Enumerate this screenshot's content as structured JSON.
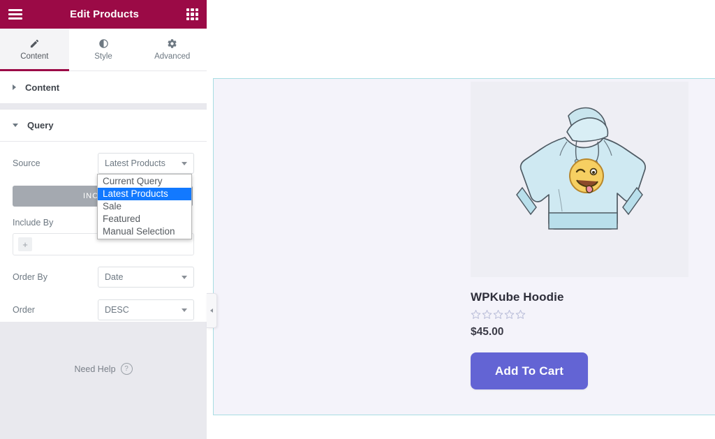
{
  "panel": {
    "header": {
      "title": "Edit Products",
      "menu_icon": "hamburger-icon",
      "apps_icon": "grid-apps-icon"
    },
    "tabs": [
      {
        "label": "Content",
        "icon": "pencil-icon",
        "active": true
      },
      {
        "label": "Style",
        "icon": "contrast-icon",
        "active": false
      },
      {
        "label": "Advanced",
        "icon": "gear-icon",
        "active": false
      }
    ],
    "sections": [
      {
        "label": "Content",
        "expanded": false
      },
      {
        "label": "Query",
        "expanded": true
      }
    ],
    "controls": {
      "source": {
        "label": "Source",
        "value": "Latest Products",
        "options": [
          "Current Query",
          "Latest Products",
          "Sale",
          "Featured",
          "Manual Selection"
        ],
        "selected_option": "Latest Products"
      },
      "include_button": "INCLUDE",
      "include_by": {
        "label": "Include By",
        "add_chip": "+"
      },
      "order_by": {
        "label": "Order By",
        "value": "Date"
      },
      "order": {
        "label": "Order",
        "value": "DESC"
      }
    },
    "footer": {
      "need_help": "Need Help",
      "help_icon": "question-mark-icon"
    },
    "collapse_handle_icon": "chevron-left-icon"
  },
  "canvas": {
    "product": {
      "image_alt": "light-blue-hoodie-with-winking-emoji",
      "title": "WPKube Hoodie",
      "rating_stars_total": 5,
      "rating_stars_filled": 0,
      "price": "$45.00",
      "add_to_cart": "Add To Cart"
    }
  },
  "colors": {
    "header_magenta": "#9b0a46",
    "dropdown_highlight": "#1279ff",
    "cart_button_purple": "#6364d4",
    "widget_border_cyan": "#a8dde3",
    "canvas_background": "#f4f3fa"
  }
}
